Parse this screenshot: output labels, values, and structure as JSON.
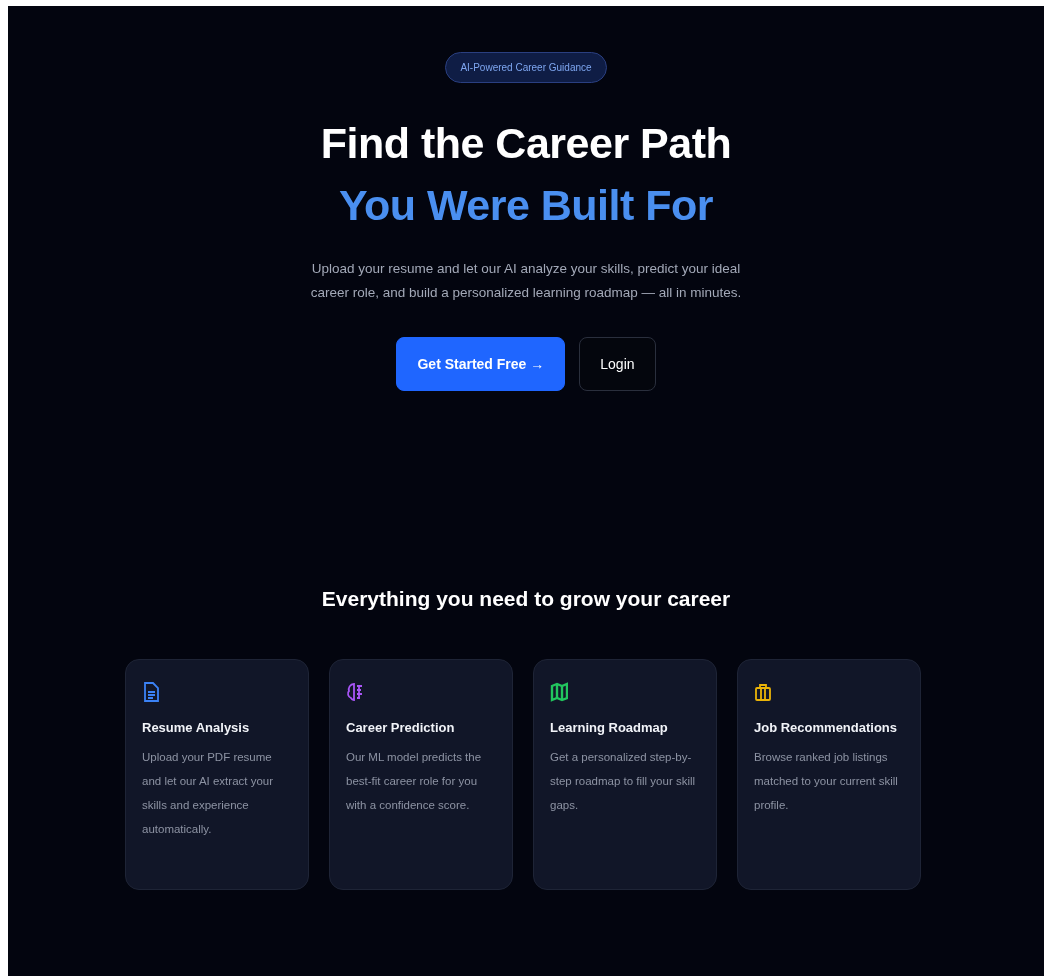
{
  "badge": "AI-Powered Career Guidance",
  "hero": {
    "title_line_1": "Find the Career Path",
    "title_line_2": "You Were Built For",
    "description": "Upload your resume and let our AI analyze your skills, predict your ideal career role, and build a personalized learning roadmap — all in minutes."
  },
  "buttons": [
    {
      "label": "Get Started Free →",
      "kind": "primary"
    },
    {
      "label": "Login",
      "kind": "outline"
    }
  ],
  "features": {
    "heading": "Everything you need to grow your career",
    "cards": [
      {
        "title": "Resume Analysis",
        "description": "Upload your PDF resume and let our AI extract your skills and experience automatically.",
        "color": "#3b82f6"
      },
      {
        "title": "Career Prediction",
        "description": "Our ML model predicts the best-fit career role for you with a confidence score.",
        "color": "#a855f7"
      },
      {
        "title": "Learning Roadmap",
        "description": "Get a personalized step-by-step roadmap to fill your skill gaps.",
        "color": "#22c55e"
      },
      {
        "title": "Job Recommendations",
        "description": "Browse ranked job listings matched to your current skill profile.",
        "color": "#eab308"
      }
    ]
  }
}
